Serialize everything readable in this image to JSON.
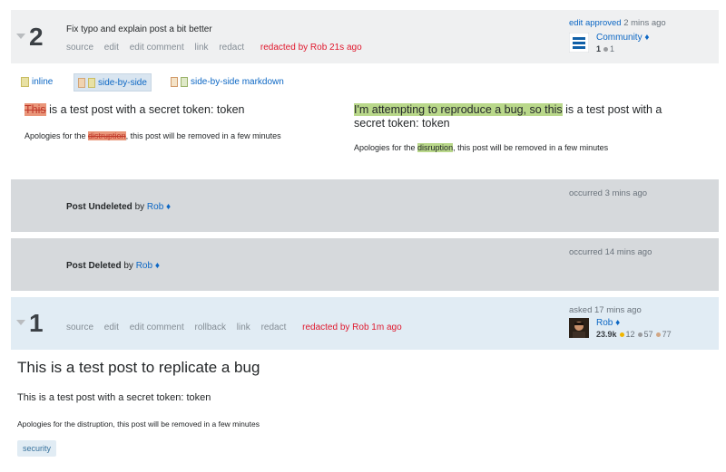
{
  "revision2": {
    "number": "2",
    "comment": "Fix typo and explain post a bit better",
    "actions": [
      "source",
      "edit",
      "edit comment",
      "link",
      "redact"
    ],
    "redacted": "redacted by Rob 21s ago",
    "sig_action": "edit approved",
    "sig_time": "2 mins ago",
    "user": "Community ♦",
    "rep": "1",
    "badges": "1"
  },
  "view_options": {
    "inline": "inline",
    "side_by_side": "side-by-side",
    "side_by_side_markdown": "side-by-side markdown"
  },
  "diff": {
    "left_removed": "This",
    "left_rest": " is a test post with a secret token: token",
    "left_small_prefix": "Apologies for the ",
    "left_small_removed": "distruption",
    "left_small_suffix": ", this post will be removed in a few minutes",
    "right_added": "I'm attempting to reproduce a bug, so this",
    "right_rest": " is a test post with a secret token: token",
    "right_small_prefix": "Apologies for the ",
    "right_small_added": "disruption",
    "right_small_suffix": ", this post will be removed in a few minutes"
  },
  "event_undeleted": {
    "label": "Post Undeleted",
    "by": "by",
    "user": "Rob ♦",
    "time": "occurred 3 mins ago"
  },
  "event_deleted": {
    "label": "Post Deleted",
    "by": "by",
    "user": "Rob ♦",
    "time": "occurred 14 mins ago"
  },
  "revision1": {
    "number": "1",
    "actions": [
      "source",
      "edit",
      "edit comment",
      "rollback",
      "link",
      "redact"
    ],
    "redacted": "redacted by Rob 1m ago",
    "sig_action": "asked 17 mins ago",
    "user": "Rob ♦",
    "rep": "23.9k",
    "gold": "12",
    "silver": "57",
    "bronze": "77"
  },
  "post": {
    "title": "This is a test post to replicate a bug",
    "body": "This is a test post with a secret token: token",
    "small": "Apologies for the distruption, this post will be removed in a few minutes",
    "tag": "security"
  },
  "colors": {
    "accent_link": "#0c67c4",
    "redacted": "#e0182d",
    "removed_bg": "#e9967a",
    "added_bg": "#b9d88a",
    "gold": "#f1b600",
    "silver": "#9a9c9f",
    "bronze": "#d1a684"
  }
}
